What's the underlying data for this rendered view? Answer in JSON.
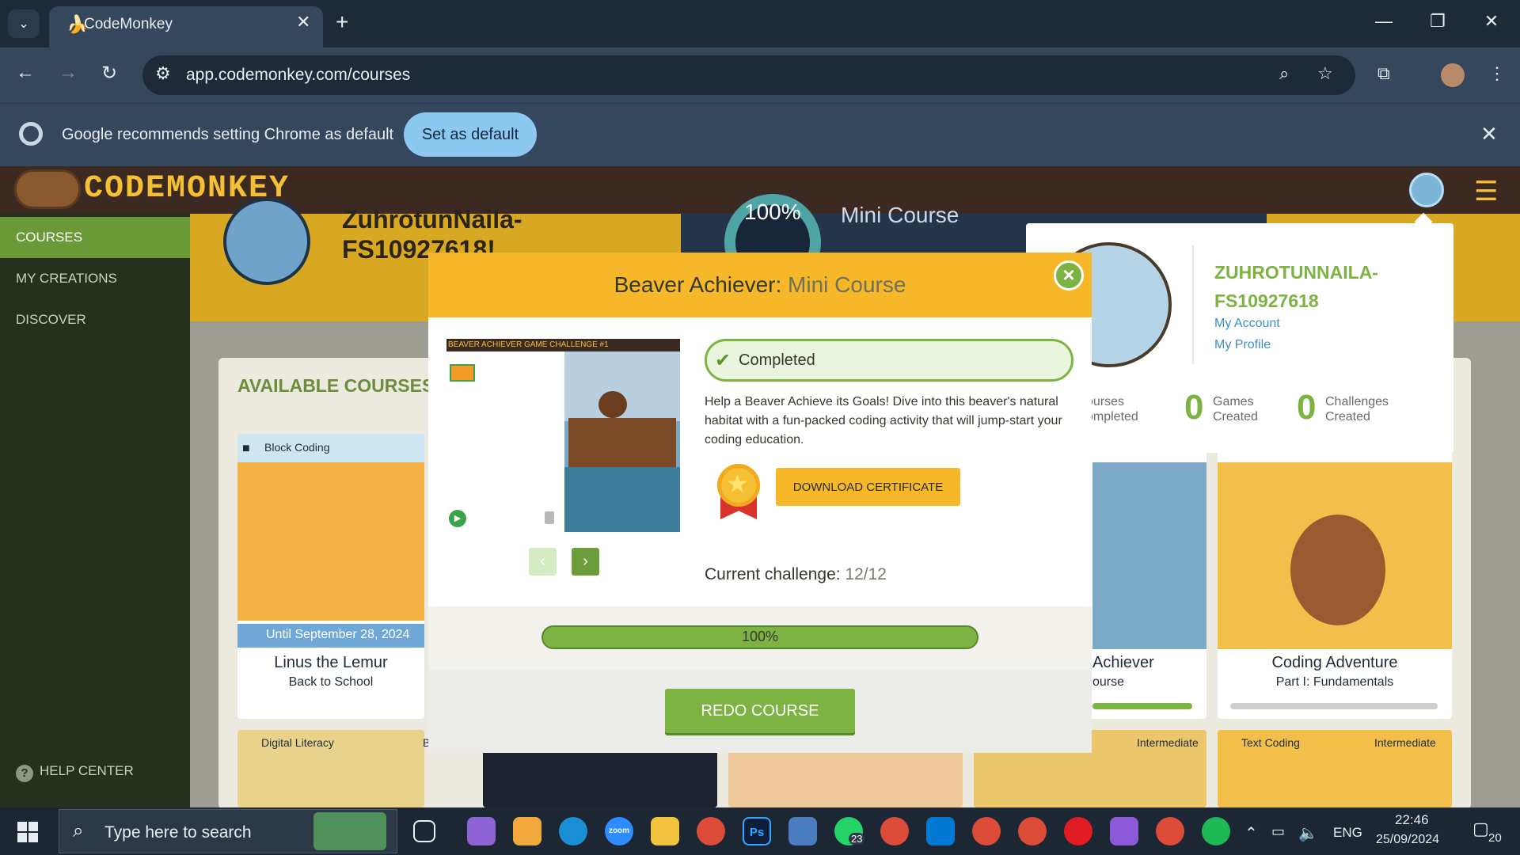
{
  "browser": {
    "tab_title": "CodeMonkey",
    "url": "app.codemonkey.com/courses",
    "infobar_text": "Google recommends setting Chrome as default",
    "infobar_button": "Set as default"
  },
  "app": {
    "logo_text": "CODEMONKEY",
    "sidebar": {
      "items": [
        "COURSES",
        "MY CREATIONS",
        "DISCOVER"
      ],
      "help": "HELP CENTER"
    },
    "banner": {
      "name": "ZuhrotunNaila-FS10927618!",
      "percent": "100%",
      "course": "Mini Course"
    },
    "available_heading": "AVAILABLE COURSES I",
    "cards": [
      {
        "tag": "Block Coding",
        "until": "Until September 28, 2024",
        "title": "Linus the Lemur",
        "sub": "Back to School"
      },
      {
        "title": "Achiever",
        "sub": "ourse",
        "progress": 1.0
      },
      {
        "title": "Coding Adventure",
        "sub": "Part I: Fundamentals"
      }
    ],
    "row2": [
      {
        "tag": "Digital Literacy",
        "badge": "B"
      },
      {
        "tag": "",
        "badge": "Intermediate"
      },
      {
        "tag": "Text Coding",
        "badge": "Intermediate"
      }
    ]
  },
  "popover": {
    "name": "ZUHROTUNNAILA-FS10927618",
    "account": "My Account",
    "profile": "My Profile",
    "stats": [
      {
        "value": "",
        "label": "ourses\nompleted"
      },
      {
        "value": "0",
        "label": "Games\nCreated"
      },
      {
        "value": "0",
        "label": "Challenges\nCreated"
      }
    ]
  },
  "modal": {
    "title": "Beaver Achiever:",
    "title_sub": " Mini Course",
    "preview_header": "BEAVER ACHIEVER GAME CHALLENGE #1",
    "status": "Completed",
    "description": "Help a Beaver Achieve its Goals! Dive into this beaver's natural habitat with a fun-packed coding activity that will jump-start your coding education.",
    "certificate_button": "DOWNLOAD CERTIFICATE",
    "challenge_label": "Current challenge: ",
    "challenge_value": "12/12",
    "progress_text": "100%",
    "progress": 1.0,
    "redo_button": "REDO COURSE"
  },
  "taskbar": {
    "search_placeholder": "Type here to search",
    "whatsapp_badge": "23",
    "lang": "ENG",
    "time": "22:46",
    "date": "25/09/2024",
    "notifications": "20"
  },
  "colors": {
    "accent_green": "#7cb342",
    "brand_yellow": "#f6b828",
    "app_header": "#3c2a22"
  }
}
